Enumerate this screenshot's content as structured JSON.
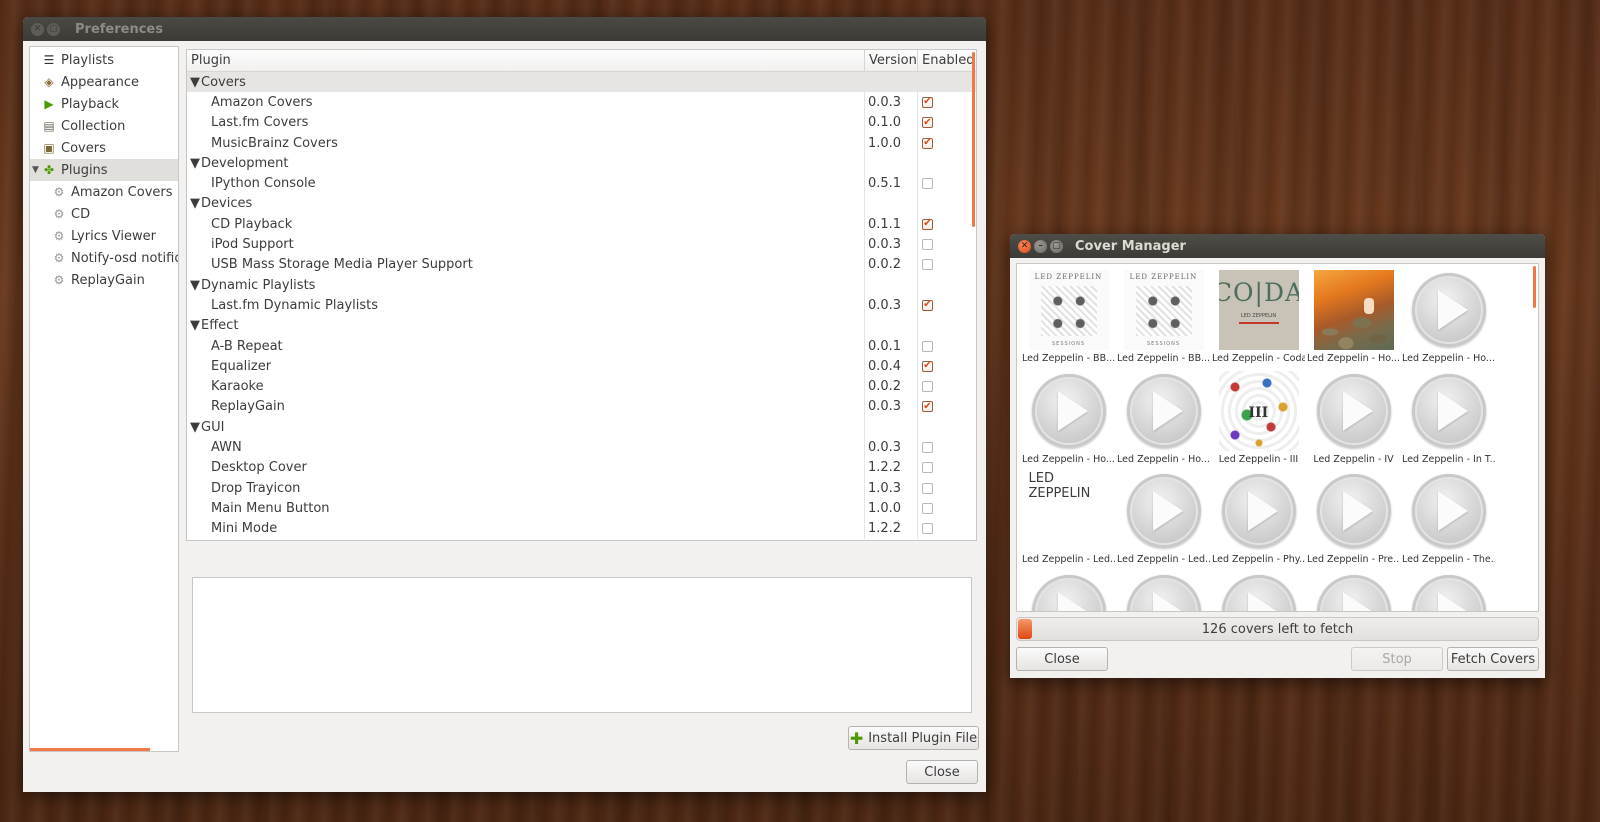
{
  "preferences": {
    "title": "Preferences",
    "sidebar": {
      "items": [
        {
          "label": "Playlists",
          "icon": "playlist-icon"
        },
        {
          "label": "Appearance",
          "icon": "appearance-icon"
        },
        {
          "label": "Playback",
          "icon": "play-icon"
        },
        {
          "label": "Collection",
          "icon": "collection-icon"
        },
        {
          "label": "Covers",
          "icon": "covers-icon"
        },
        {
          "label": "Plugins",
          "icon": "puzzle-icon"
        }
      ],
      "plugin_children": [
        {
          "label": "Amazon Covers"
        },
        {
          "label": "CD"
        },
        {
          "label": "Lyrics Viewer"
        },
        {
          "label": "Notify-osd notifica"
        },
        {
          "label": "ReplayGain"
        }
      ]
    },
    "table": {
      "headers": {
        "plugin": "Plugin",
        "version": "Version",
        "enabled": "Enabled"
      },
      "rows": [
        {
          "type": "category",
          "name": "Covers"
        },
        {
          "type": "plugin",
          "name": "Amazon Covers",
          "version": "0.0.3",
          "enabled": true
        },
        {
          "type": "plugin",
          "name": "Last.fm Covers",
          "version": "0.1.0",
          "enabled": true
        },
        {
          "type": "plugin",
          "name": "MusicBrainz Covers",
          "version": "1.0.0",
          "enabled": true
        },
        {
          "type": "category",
          "name": "Development"
        },
        {
          "type": "plugin",
          "name": "IPython Console",
          "version": "0.5.1",
          "enabled": false
        },
        {
          "type": "category",
          "name": "Devices"
        },
        {
          "type": "plugin",
          "name": "CD Playback",
          "version": "0.1.1",
          "enabled": true
        },
        {
          "type": "plugin",
          "name": "iPod Support",
          "version": "0.0.3",
          "enabled": false
        },
        {
          "type": "plugin",
          "name": "USB Mass Storage Media Player Support",
          "version": "0.0.2",
          "enabled": false
        },
        {
          "type": "category",
          "name": "Dynamic Playlists"
        },
        {
          "type": "plugin",
          "name": "Last.fm Dynamic Playlists",
          "version": "0.0.3",
          "enabled": true
        },
        {
          "type": "category",
          "name": "Effect"
        },
        {
          "type": "plugin",
          "name": "A-B Repeat",
          "version": "0.0.1",
          "enabled": false
        },
        {
          "type": "plugin",
          "name": "Equalizer",
          "version": "0.0.4",
          "enabled": true
        },
        {
          "type": "plugin",
          "name": "Karaoke",
          "version": "0.0.2",
          "enabled": false
        },
        {
          "type": "plugin",
          "name": "ReplayGain",
          "version": "0.0.3",
          "enabled": true
        },
        {
          "type": "category",
          "name": "GUI"
        },
        {
          "type": "plugin",
          "name": "AWN",
          "version": "0.0.3",
          "enabled": false
        },
        {
          "type": "plugin",
          "name": "Desktop Cover",
          "version": "1.2.2",
          "enabled": false
        },
        {
          "type": "plugin",
          "name": "Drop Trayicon",
          "version": "1.0.3",
          "enabled": false
        },
        {
          "type": "plugin",
          "name": "Main Menu Button",
          "version": "1.0.0",
          "enabled": false
        },
        {
          "type": "plugin",
          "name": "Mini Mode",
          "version": "1.2.2",
          "enabled": false
        }
      ]
    },
    "install_button": "Install Plugin File",
    "close_button": "Close"
  },
  "cover_manager": {
    "title": "Cover Manager",
    "covers": [
      {
        "label": "Led Zeppelin - BB...",
        "art": "bbc"
      },
      {
        "label": "Led Zeppelin - BB...",
        "art": "bbc"
      },
      {
        "label": "Led Zeppelin - Coda",
        "art": "coda"
      },
      {
        "label": "Led Zeppelin - Ho...",
        "art": "hoth"
      },
      {
        "label": "Led Zeppelin - Ho...",
        "art": "placeholder"
      },
      {
        "label": "Led Zeppelin - Ho...",
        "art": "placeholder"
      },
      {
        "label": "Led Zeppelin - Ho...",
        "art": "placeholder"
      },
      {
        "label": "Led Zeppelin - III",
        "art": "iii"
      },
      {
        "label": "Led Zeppelin - IV",
        "art": "placeholder"
      },
      {
        "label": "Led Zeppelin - In T...",
        "art": "placeholder"
      },
      {
        "label": "Led Zeppelin - Led...",
        "art": "zeppelin"
      },
      {
        "label": "Led Zeppelin - Led...",
        "art": "placeholder"
      },
      {
        "label": "Led Zeppelin - Phy...",
        "art": "placeholder"
      },
      {
        "label": "Led Zeppelin - Pre...",
        "art": "placeholder"
      },
      {
        "label": "Led Zeppelin - The...",
        "art": "placeholder"
      },
      {
        "label": "",
        "art": "placeholder"
      },
      {
        "label": "",
        "art": "placeholder"
      },
      {
        "label": "",
        "art": "placeholder"
      },
      {
        "label": "",
        "art": "placeholder"
      },
      {
        "label": "",
        "art": "placeholder"
      }
    ],
    "album_art_text": {
      "bbc_title": "LED ZEPPELIN",
      "bbc_bottom": "SESSIONS",
      "coda": "CO|DA",
      "coda_small": "LED ZEPPELIN",
      "iii": "III",
      "zep_logo": "LED ZEPPELIN"
    },
    "progress_text": "126 covers left to fetch",
    "progress_fraction": 0.02,
    "buttons": {
      "close": "Close",
      "stop": "Stop",
      "fetch": "Fetch Covers"
    }
  },
  "colors": {
    "accent": "#f07746",
    "ubuntu_orange": "#dd4814"
  }
}
